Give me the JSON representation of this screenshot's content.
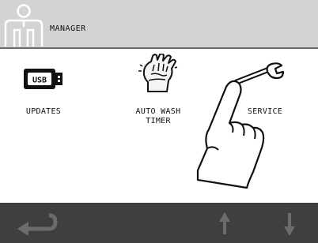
{
  "header": {
    "title": "MANAGER",
    "icon": "user-manager-icon"
  },
  "tiles": [
    {
      "label": "UPDATES",
      "icon": "usb-drive-icon",
      "icon_text": "USB"
    },
    {
      "label": "AUTO WASH TIMER",
      "line1": "AUTO WASH",
      "line2": "TIMER",
      "icon": "washing-hand-icon"
    },
    {
      "label": "SERVICE",
      "icon": "wrench-icon"
    }
  ],
  "overlay": {
    "icon": "pointing-hand-icon"
  },
  "footer": {
    "back_icon": "return-arrow-icon",
    "up_icon": "arrow-up-icon",
    "down_icon": "arrow-down-icon"
  },
  "colors": {
    "header_bg": "#d3d3d3",
    "footer_bg": "#3f3f3f",
    "footer_icons": "#6c6c6c",
    "text": "#111111"
  }
}
